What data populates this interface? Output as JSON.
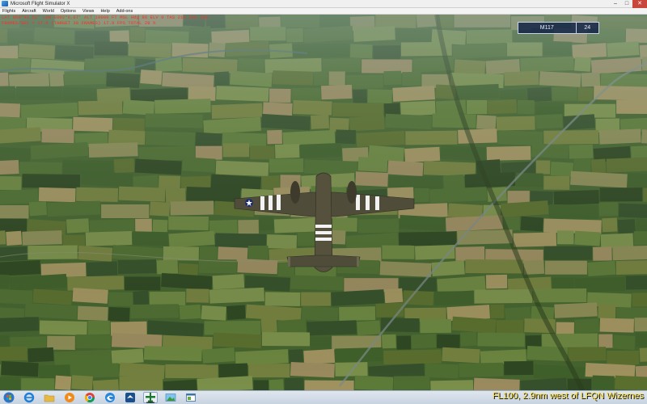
{
  "window": {
    "title": "Microsoft Flight Simulator X",
    "controls": {
      "minimize": "–",
      "maximize": "□",
      "close": "✕"
    }
  },
  "menu": {
    "items": [
      "Flights",
      "Aircraft",
      "World",
      "Options",
      "Views",
      "Help",
      "Add-ons"
    ]
  },
  "overlay": {
    "debug_line_1": "LAT N50°43.52' LON E002°6.67' ALT 10000 FT MSL  Hdg 86  ELV 0   TAS 210 IAS 198",
    "debug_line_2": "FRAMES/SEC = 17.9  (TARGET 30 FRAMES)  17.9 FPS  TOTAL 28 %",
    "hud_label": "M117",
    "hud_value": "24"
  },
  "caption": "FL100, 2.9nm west of LFQN Wizernes",
  "taskbar": {
    "icons": [
      "start-orb-icon",
      "internet-explorer-icon",
      "folder-icon",
      "media-player-icon",
      "chrome-icon",
      "edge-icon",
      "flight-sim-icon",
      "aircraft-icon",
      "picture-viewer-icon",
      "window-icon"
    ]
  },
  "colors": {
    "debug_text": "#ff2b2b",
    "caption_text": "#ffe23a",
    "hud_bg": "#142446"
  }
}
